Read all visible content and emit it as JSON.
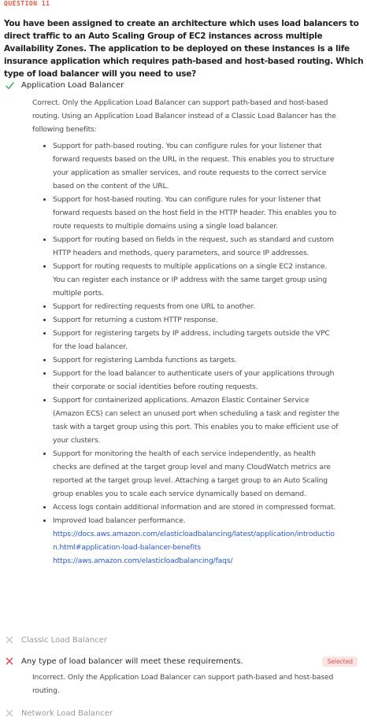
{
  "question": {
    "label": "QUESTION 11",
    "text": "You have been assigned to create an architecture which uses load balancers to direct traffic to an Auto Scaling Group of EC2 instances across multiple Availability Zones. The application to be deployed on these instances is a life insurance application which requires path-based and host-based routing. Which type of load balancer will you need to use?"
  },
  "options": [
    {
      "label": "Application Load Balancer",
      "status": "correct",
      "explanation": "Correct. Only the Application Load Balancer can support path-based and host-based routing. Using an Application Load Balancer instead of a Classic Load Balancer has the following benefits:",
      "bullets": [
        "Support for path-based routing. You can configure rules for your listener that forward requests based on the URL in the request. This enables you to structure your application as smaller services, and route requests to the correct service based on the content of the URL.",
        "Support for host-based routing. You can configure rules for your listener that forward requests based on the host field in the HTTP header. This enables you to route requests to multiple domains using a single load balancer.",
        "Support for routing based on fields in the request, such as standard and custom HTTP headers and methods, query parameters, and source IP addresses.",
        "Support for routing requests to multiple applications on a single EC2 instance. You can register each instance or IP address with the same target group using multiple ports.",
        "Support for redirecting requests from one URL to another.",
        "Support for returning a custom HTTP response.",
        "Support for registering targets by IP address, including targets outside the VPC for the load balancer.",
        "Support for registering Lambda functions as targets.",
        "Support for the load balancer to authenticate users of your applications through their corporate or social identities before routing requests.",
        "Support for containerized applications. Amazon Elastic Container Service (Amazon ECS) can select an unused port when scheduling a task and register the task with a target group using this port. This enables you to make efficient use of your clusters.",
        "Support for monitoring the health of each service independently, as health checks are defined at the target group level and many CloudWatch metrics are reported at the target group level. Attaching a target group to an Auto Scaling group enables you to scale each service dynamically based on demand.",
        "Access logs contain additional information and are stored in compressed format.",
        "Improved load balancer performance."
      ],
      "links": [
        "https://docs.aws.amazon.com/elasticloadbalancing/latest/application/introduction.html#application-load-balancer-benefits",
        "https://aws.amazon.com/elasticloadbalancing/faqs/"
      ]
    },
    {
      "label": "Classic Load Balancer",
      "status": "unselected"
    },
    {
      "label": "Any type of load balancer will meet these requirements.",
      "status": "incorrect",
      "badge": "Selected",
      "explanation": "Incorrect. Only the Application Load Balancer can support path-based and host-based routing."
    },
    {
      "label": "Network Load Balancer",
      "status": "unselected"
    }
  ],
  "colors": {
    "correct": "#3fae6a",
    "incorrect": "#e0465a",
    "muted": "#c4c4c4",
    "link": "#2a57c8",
    "accent": "#e8553e"
  },
  "icons": {
    "correct": "check-icon",
    "incorrect": "x-icon",
    "muted": "x-icon"
  }
}
